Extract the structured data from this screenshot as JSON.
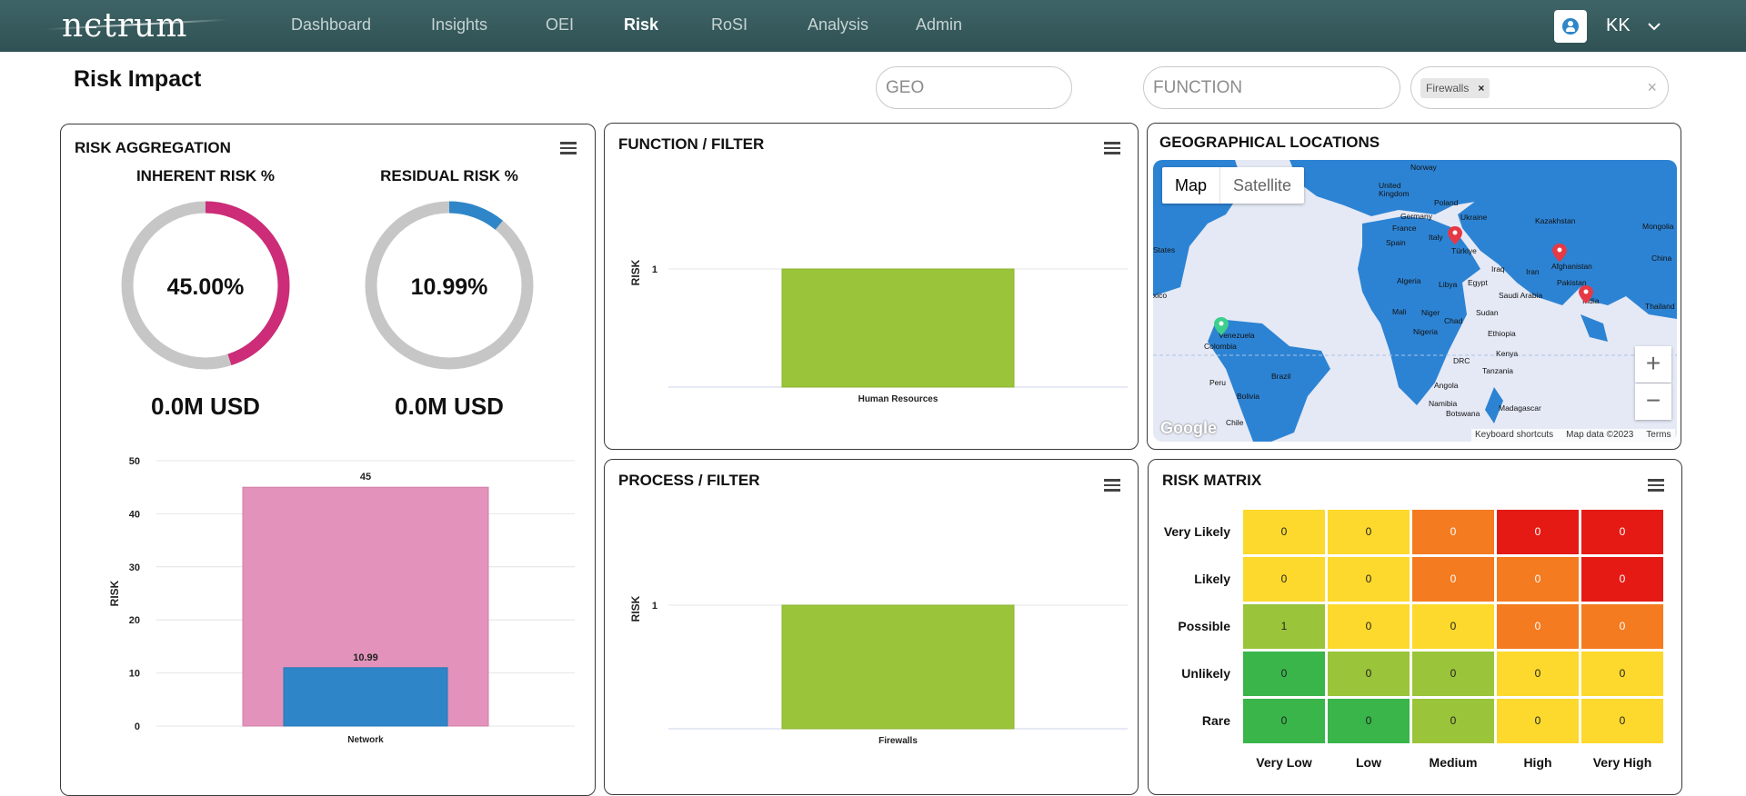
{
  "app": {
    "logo_text": "nєtrum",
    "nav": [
      "Dashboard",
      "Insights",
      "OEI",
      "Risk",
      "RoSI",
      "Analysis",
      "Admin"
    ],
    "active_nav": "Risk",
    "user_initials": "KK"
  },
  "page": {
    "title": "Risk Impact"
  },
  "filters": {
    "geo_placeholder": "GEO",
    "function_placeholder": "FUNCTION",
    "selected_chip": "Firewalls",
    "chip_remove": "×",
    "clear": "×"
  },
  "risk_aggregation": {
    "title": "RISK AGGREGATION",
    "inherent": {
      "label": "INHERENT RISK %",
      "value_text": "45.00%",
      "fraction": 0.45,
      "color": "#cc2c78",
      "usd": "0.0M USD"
    },
    "residual": {
      "label": "RESIDUAL RISK %",
      "value_text": "10.99%",
      "fraction": 0.1099,
      "color": "#2e86c8",
      "usd": "0.0M USD"
    },
    "track_color": "#c6c6c6"
  },
  "function_filter": {
    "title": "FUNCTION / FILTER"
  },
  "process_filter": {
    "title": "PROCESS / FILTER"
  },
  "geo": {
    "title": "GEOGRAPHICAL LOCATIONS",
    "map_button": "Map",
    "satellite_button": "Satellite",
    "zoom_in": "+",
    "zoom_out": "−",
    "google": "Google",
    "footer": [
      "Keyboard shortcuts",
      "Map data ©2023",
      "Terms"
    ],
    "country_labels": [
      "Norway",
      "United Kingdom",
      "Poland",
      "Germany",
      "Ukraine",
      "Kazakhstan",
      "France",
      "Italy",
      "Mongolia",
      "Spain",
      "Türkiye",
      "Afghanistan",
      "China",
      "Iraq",
      "Iran",
      "Algeria",
      "Libya",
      "Egypt",
      "Saudi Arabia",
      "Pakistan",
      "India",
      "Thailand",
      "Mali",
      "Niger",
      "Sudan",
      "Chad",
      "Nigeria",
      "Ethiopia",
      "Venezuela",
      "Colombia",
      "Kenya",
      "DRC",
      "Tanzania",
      "Peru",
      "Brazil",
      "Angola",
      "Bolivia",
      "Namibia",
      "Botswana",
      "Madagascar",
      "Chile",
      "States",
      "xico"
    ],
    "water_color": "#e5e9f5",
    "land_color": "#2d83d3",
    "marker_color": "#e53945",
    "marker_alt_color": "#3ecf8e"
  },
  "risk_matrix": {
    "title": "RISK MATRIX",
    "rows": [
      "Very Likely",
      "Likely",
      "Possible",
      "Unlikely",
      "Rare"
    ],
    "cols": [
      "Very Low",
      "Low",
      "Medium",
      "High",
      "Very High"
    ],
    "values": [
      [
        0,
        0,
        0,
        0,
        0
      ],
      [
        0,
        0,
        0,
        0,
        0
      ],
      [
        1,
        0,
        0,
        0,
        0
      ],
      [
        0,
        0,
        0,
        0,
        0
      ],
      [
        0,
        0,
        0,
        0,
        0
      ]
    ],
    "colors": [
      [
        "#fcd92c",
        "#fcd92c",
        "#f47b20",
        "#e51a14",
        "#e51a14"
      ],
      [
        "#fcd92c",
        "#fcd92c",
        "#f47b20",
        "#f47b20",
        "#e51a14"
      ],
      [
        "#9ac439",
        "#fcd92c",
        "#fcd92c",
        "#f47b20",
        "#f47b20"
      ],
      [
        "#39b54a",
        "#9ac439",
        "#9ac439",
        "#fcd92c",
        "#fcd92c"
      ],
      [
        "#39b54a",
        "#39b54a",
        "#9ac439",
        "#fcd92c",
        "#fcd92c"
      ]
    ]
  },
  "chart_data": [
    {
      "type": "bar",
      "title": "",
      "ylabel": "RISK",
      "categories": [
        "Network"
      ],
      "ylim": [
        0,
        50
      ],
      "yticks": [
        0,
        10,
        20,
        30,
        40,
        50
      ],
      "series": [
        {
          "values": [
            45
          ],
          "color": "#e393bb",
          "labels": [
            "45"
          ]
        },
        {
          "values": [
            10.99
          ],
          "color": "#2e86c8",
          "labels": [
            "10.99"
          ]
        }
      ]
    },
    {
      "type": "bar",
      "title": "FUNCTION / FILTER",
      "ylabel": "RISK",
      "categories": [
        "Human Resources"
      ],
      "yticks": [
        1
      ],
      "values": [
        1
      ],
      "color": "#9ac439"
    },
    {
      "type": "bar",
      "title": "PROCESS / FILTER",
      "ylabel": "RISK",
      "categories": [
        "Firewalls"
      ],
      "yticks": [
        1
      ],
      "values": [
        1
      ],
      "color": "#9ac439"
    }
  ]
}
